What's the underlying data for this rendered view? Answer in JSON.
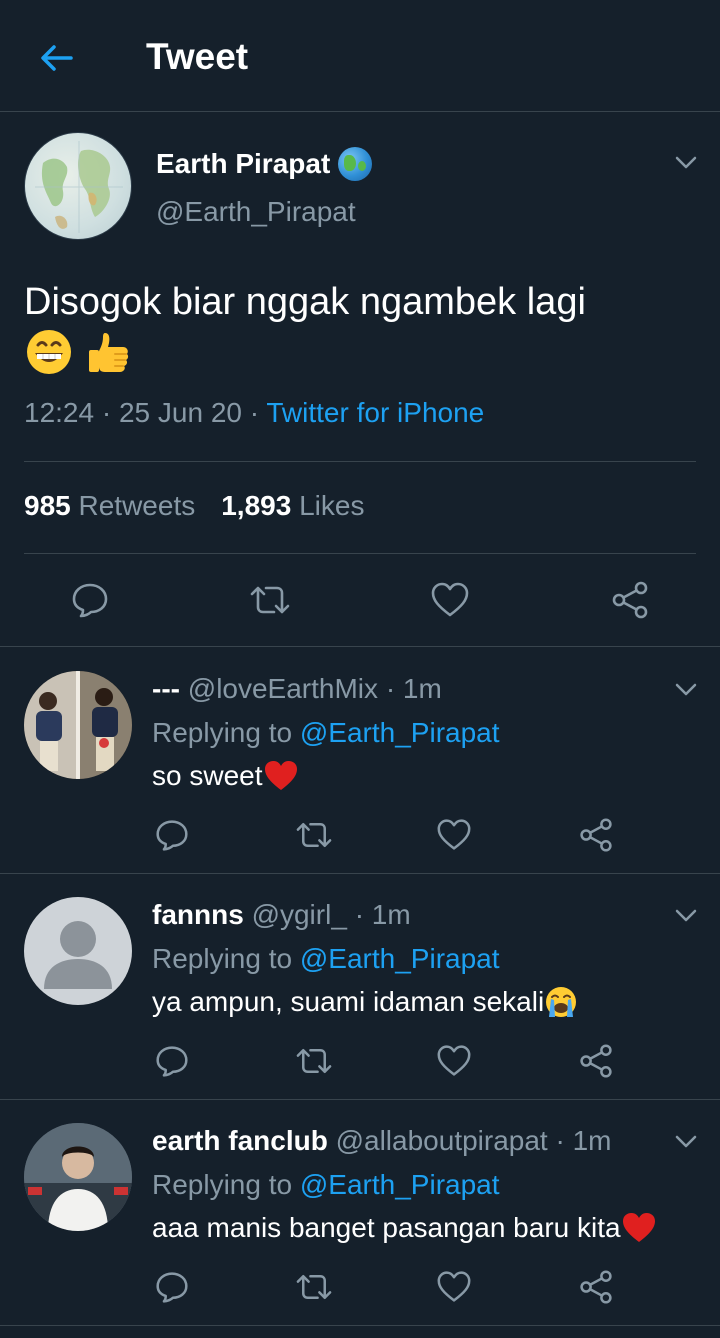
{
  "header": {
    "title": "Tweet"
  },
  "tweet": {
    "name": "Earth Pirapat",
    "handle": "@Earth_Pirapat",
    "text": "Disogok biar nggak ngambek lagi",
    "time": "12:24",
    "date": "25 Jun 20",
    "source": "Twitter for iPhone",
    "retweets_count": "985",
    "retweets_label": "Retweets",
    "likes_count": "1,893",
    "likes_label": "Likes"
  },
  "replies": [
    {
      "name": "---",
      "handle": "@loveEarthMix",
      "time": "1m",
      "replying_label": "Replying to",
      "replying_to": "@Earth_Pirapat",
      "text": "so sweet",
      "emoji": "red-heart"
    },
    {
      "name": "fannns",
      "handle": "@ygirl_",
      "time": "1m",
      "replying_label": "Replying to",
      "replying_to": "@Earth_Pirapat",
      "text": "ya ampun, suami idaman sekali",
      "emoji": "crying-face"
    },
    {
      "name": "earth fanclub",
      "handle": "@allaboutpirapat",
      "time": "1m",
      "replying_label": "Replying to",
      "replying_to": "@Earth_Pirapat",
      "text": "aaa manis banget pasangan baru kita",
      "emoji": "red-heart"
    }
  ],
  "colors": {
    "background": "#15202b",
    "accent": "#1da1f2",
    "secondary_text": "#8899a6",
    "divider": "#38444d"
  }
}
